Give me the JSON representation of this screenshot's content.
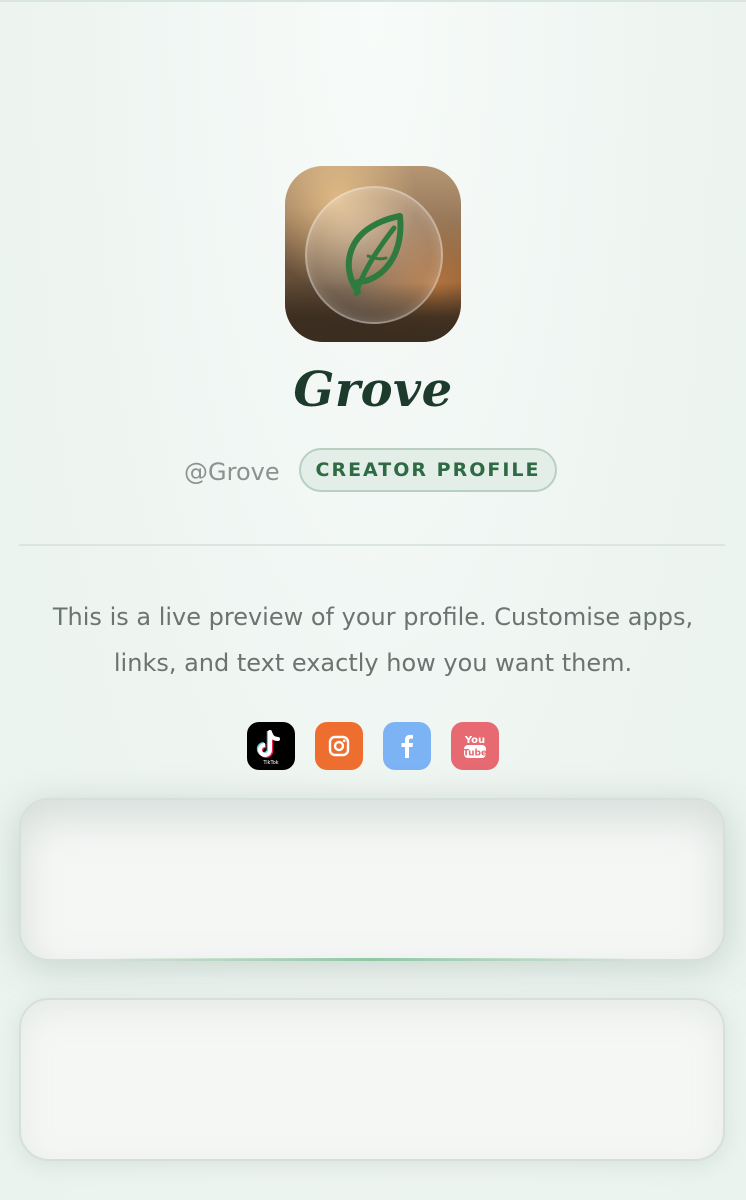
{
  "profile": {
    "name": "Grove",
    "handle": "@Grove",
    "badge": "CREATOR PROFILE",
    "bio": "This is a live preview of your profile. Customise apps, links, and text exactly how you want them."
  },
  "avatar": {
    "icon": "leaf-icon",
    "colors": {
      "leaf": "#2f7a3f"
    }
  },
  "socials": [
    {
      "name": "tiktok",
      "icon": "tiktok-icon",
      "label": "TikTok",
      "color": "#000000"
    },
    {
      "name": "instagram",
      "icon": "instagram-icon",
      "color": "#ee6e2f"
    },
    {
      "name": "facebook",
      "icon": "facebook-icon",
      "color": "#7cb3f4"
    },
    {
      "name": "youtube",
      "icon": "youtube-icon",
      "label_top": "You",
      "label_bottom": "Tube",
      "color": "#e76971"
    }
  ],
  "colors": {
    "accent": "#2f6a45",
    "title": "#1d3b2c",
    "background": "#eef5f1"
  }
}
